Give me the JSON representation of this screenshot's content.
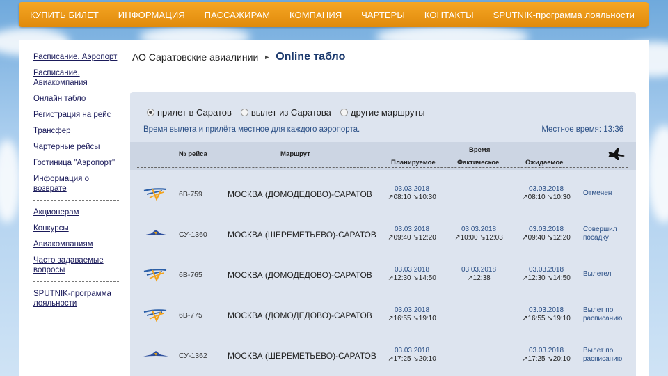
{
  "nav": [
    "КУПИТЬ БИЛЕТ",
    "ИНФОРМАЦИЯ",
    "ПАССАЖИРАМ",
    "КОМПАНИЯ",
    "ЧАРТЕРЫ",
    "КОНТАКТЫ",
    "SPUTNIK-программа лояльности"
  ],
  "sidebar": {
    "group1": [
      "Расписание. Аэропорт",
      "Расписание. Авиакомпания",
      "Онлайн табло",
      "Регистрация на рейс",
      "Трансфер",
      "Чартерные рейсы",
      "Гостиница \"Аэропорт\"",
      "Информация о возврате"
    ],
    "group2": [
      "Акционерам",
      "Конкурсы",
      "Авиакомпаниям",
      "Часто задаваемые вопросы"
    ],
    "group3": [
      "SPUTNIK-программа лояльности"
    ]
  },
  "breadcrumb": {
    "org": "АО Саратовские авиалинии",
    "current": "Online табло"
  },
  "filters": [
    {
      "label": "прилет в Саратов",
      "checked": true
    },
    {
      "label": "вылет из Саратова",
      "checked": false
    },
    {
      "label": "другие маршруты",
      "checked": false
    }
  ],
  "note": "Время вылета и прилёта местное для каждого аэропорта.",
  "local_time": "Местное время: 13:36",
  "table": {
    "headers": {
      "flight": "№ рейса",
      "route": "Маршрут",
      "time_group": "Время",
      "planned": "Планируемое",
      "actual": "Фактическое",
      "expected": "Ожидаемое"
    },
    "header_icon": "plane-icon",
    "rows": [
      {
        "logo": "saratov-airlines-logo",
        "flight": "6В-759",
        "route": "МОСКВА (ДОМОДЕДОВО)-САРАТОВ",
        "planned": {
          "date": "03.03.2018",
          "times": "↗08:10 ↘10:30"
        },
        "actual": {
          "date": "",
          "times": ""
        },
        "expected": {
          "date": "03.03.2018",
          "times": "↗08:10 ↘10:30"
        },
        "status": "Отменен"
      },
      {
        "logo": "aeroflot-logo",
        "flight": "СУ-1360",
        "route": "МОСКВА (ШЕРЕМЕТЬЕВО)-САРАТОВ",
        "planned": {
          "date": "03.03.2018",
          "times": "↗09:40 ↘12:20"
        },
        "actual": {
          "date": "03.03.2018",
          "times": "↗10:00 ↘12:03"
        },
        "expected": {
          "date": "03.03.2018",
          "times": "↗09:40 ↘12:20"
        },
        "status": "Совершил посадку"
      },
      {
        "logo": "saratov-airlines-logo",
        "flight": "6В-765",
        "route": "МОСКВА (ДОМОДЕДОВО)-САРАТОВ",
        "planned": {
          "date": "03.03.2018",
          "times": "↗12:30 ↘14:50"
        },
        "actual": {
          "date": "03.03.2018",
          "times": "↗12:38"
        },
        "expected": {
          "date": "03.03.2018",
          "times": "↗12:30 ↘14:50"
        },
        "status": "Вылетел"
      },
      {
        "logo": "saratov-airlines-logo",
        "flight": "6В-775",
        "route": "МОСКВА (ДОМОДЕДОВО)-САРАТОВ",
        "planned": {
          "date": "03.03.2018",
          "times": "↗16:55 ↘19:10"
        },
        "actual": {
          "date": "",
          "times": ""
        },
        "expected": {
          "date": "03.03.2018",
          "times": "↗16:55 ↘19:10"
        },
        "status": "Вылет по расписанию"
      },
      {
        "logo": "aeroflot-logo",
        "flight": "СУ-1362",
        "route": "МОСКВА (ШЕРЕМЕТЬЕВО)-САРАТОВ",
        "planned": {
          "date": "03.03.2018",
          "times": "↗17:25 ↘20:10"
        },
        "actual": {
          "date": "",
          "times": ""
        },
        "expected": {
          "date": "03.03.2018",
          "times": "↗17:25 ↘20:10"
        },
        "status": "Вылет по расписанию"
      }
    ]
  },
  "colors": {
    "nav_orange": "#f0a020",
    "board_bg": "#dde4ef",
    "link_blue": "#2a4f86",
    "title_navy": "#1c3a6e"
  }
}
